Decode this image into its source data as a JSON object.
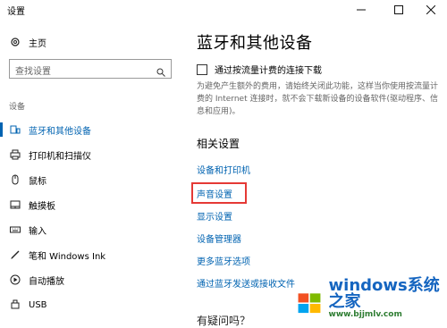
{
  "window": {
    "title": "设置"
  },
  "sidebar": {
    "home": "主页",
    "search_placeholder": "查找设置",
    "group_label": "设备",
    "items": [
      {
        "label": "蓝牙和其他设备",
        "icon": "bluetooth-icon",
        "active": true
      },
      {
        "label": "打印机和扫描仪",
        "icon": "printer-icon"
      },
      {
        "label": "鼠标",
        "icon": "mouse-icon"
      },
      {
        "label": "触摸板",
        "icon": "touchpad-icon"
      },
      {
        "label": "输入",
        "icon": "keyboard-icon"
      },
      {
        "label": "笔和 Windows Ink",
        "icon": "pen-icon"
      },
      {
        "label": "自动播放",
        "icon": "autoplay-icon"
      },
      {
        "label": "USB",
        "icon": "usb-icon"
      }
    ]
  },
  "main": {
    "title": "蓝牙和其他设备",
    "metered_checkbox_label": "通过按流量计费的连接下载",
    "metered_checked": false,
    "description": "为避免产生额外的费用，请始终关闭此功能，这样当你使用按流量计费的 Internet 连接时，就不会下载新设备的设备软件(驱动程序、信息和应用)。",
    "related_heading": "相关设置",
    "links": [
      "设备和打印机",
      "声音设置",
      "显示设置",
      "设备管理器",
      "更多蓝牙选项",
      "通过蓝牙发送或接收文件"
    ],
    "bottom_heading": "有疑问吗？"
  },
  "watermark": {
    "text": "windows系统之家",
    "sub": "www.bjjmlv.com"
  },
  "colors": {
    "accent": "#0063b1",
    "highlight": "#e53935"
  }
}
